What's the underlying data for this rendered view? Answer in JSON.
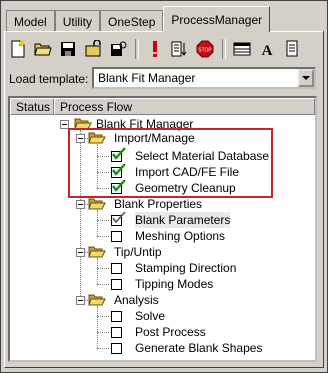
{
  "tabs": [
    "Model",
    "Utility",
    "OneStep",
    "ProcessManager"
  ],
  "active_tab": "ProcessManager",
  "toolbar": {
    "icons": [
      "new-icon",
      "open-icon",
      "save-icon",
      "unlock-icon",
      "lock-save-icon",
      "exclamation-icon",
      "list-icon",
      "stop-icon",
      "table-icon",
      "font-icon",
      "document-icon"
    ]
  },
  "load_template": {
    "label": "Load template:",
    "value": "Blank Fit Manager"
  },
  "tree": {
    "columns": [
      "Status",
      "Process Flow"
    ],
    "root": "Blank Fit Manager",
    "groups": [
      {
        "label": "Import/Manage",
        "items": [
          {
            "label": "Select Material Database",
            "checked": true
          },
          {
            "label": "Import CAD/FE File",
            "checked": true
          },
          {
            "label": "Geometry Cleanup",
            "checked": true
          }
        ]
      },
      {
        "label": "Blank Properties",
        "items": [
          {
            "label": "Blank Parameters",
            "checked": true
          },
          {
            "label": "Meshing Options",
            "checked": false
          }
        ]
      },
      {
        "label": "Tip/Untip",
        "items": [
          {
            "label": "Stamping Direction",
            "checked": false
          },
          {
            "label": "Tipping Modes",
            "checked": false
          }
        ]
      },
      {
        "label": "Analysis",
        "items": [
          {
            "label": "Solve",
            "checked": false
          },
          {
            "label": "Post Process",
            "checked": false
          },
          {
            "label": "Generate Blank Shapes",
            "checked": false
          }
        ]
      }
    ]
  },
  "colors": {
    "highlight_box": "#c0272d",
    "check_green": "#1a8f1a",
    "folder": "#e8c85a"
  }
}
